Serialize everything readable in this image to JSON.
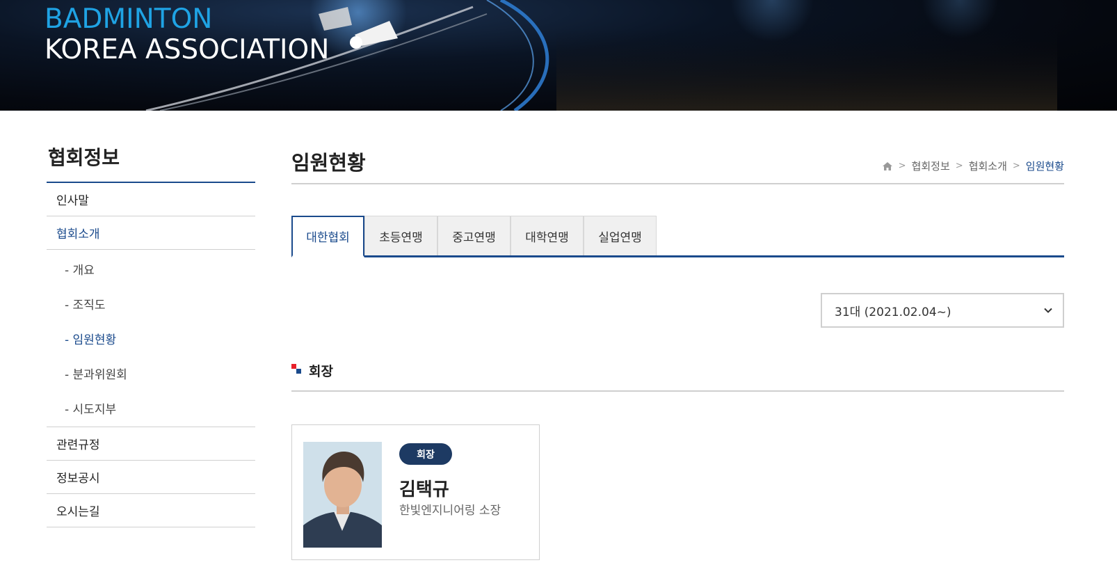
{
  "brand": {
    "line1": "BADMINTON",
    "line2": "KOREA ASSOCIATION"
  },
  "sidebar": {
    "title": "협회정보",
    "items": [
      {
        "label": "인사말",
        "active": false
      },
      {
        "label": "협회소개",
        "active": true
      },
      {
        "label": "관련규정",
        "active": false
      },
      {
        "label": "정보공시",
        "active": false
      },
      {
        "label": "오시는길",
        "active": false
      }
    ],
    "sub_items": [
      {
        "label": "- 개요",
        "active": false
      },
      {
        "label": "- 조직도",
        "active": false
      },
      {
        "label": "- 임원현황",
        "active": true
      },
      {
        "label": "- 분과위원회",
        "active": false
      },
      {
        "label": "- 시도지부",
        "active": false
      }
    ]
  },
  "main": {
    "title": "임원현황",
    "breadcrumb": [
      "협회정보",
      "협회소개",
      "임원현황"
    ],
    "tabs": [
      {
        "label": "대한협회",
        "active": true
      },
      {
        "label": "초등연맹",
        "active": false
      },
      {
        "label": "중고연맹",
        "active": false
      },
      {
        "label": "대학연맹",
        "active": false
      },
      {
        "label": "실업연맹",
        "active": false
      }
    ],
    "term_select": {
      "value": "31대 (2021.02.04~)"
    },
    "section_title": "회장",
    "card": {
      "badge": "회장",
      "name": "김택규",
      "org": "한빛엔지니어링 소장"
    }
  },
  "colors": {
    "accent": "#1a4a8c",
    "brand_blue": "#1fa3e4",
    "badge": "#1d3a63",
    "mark_red": "#e8202a"
  }
}
